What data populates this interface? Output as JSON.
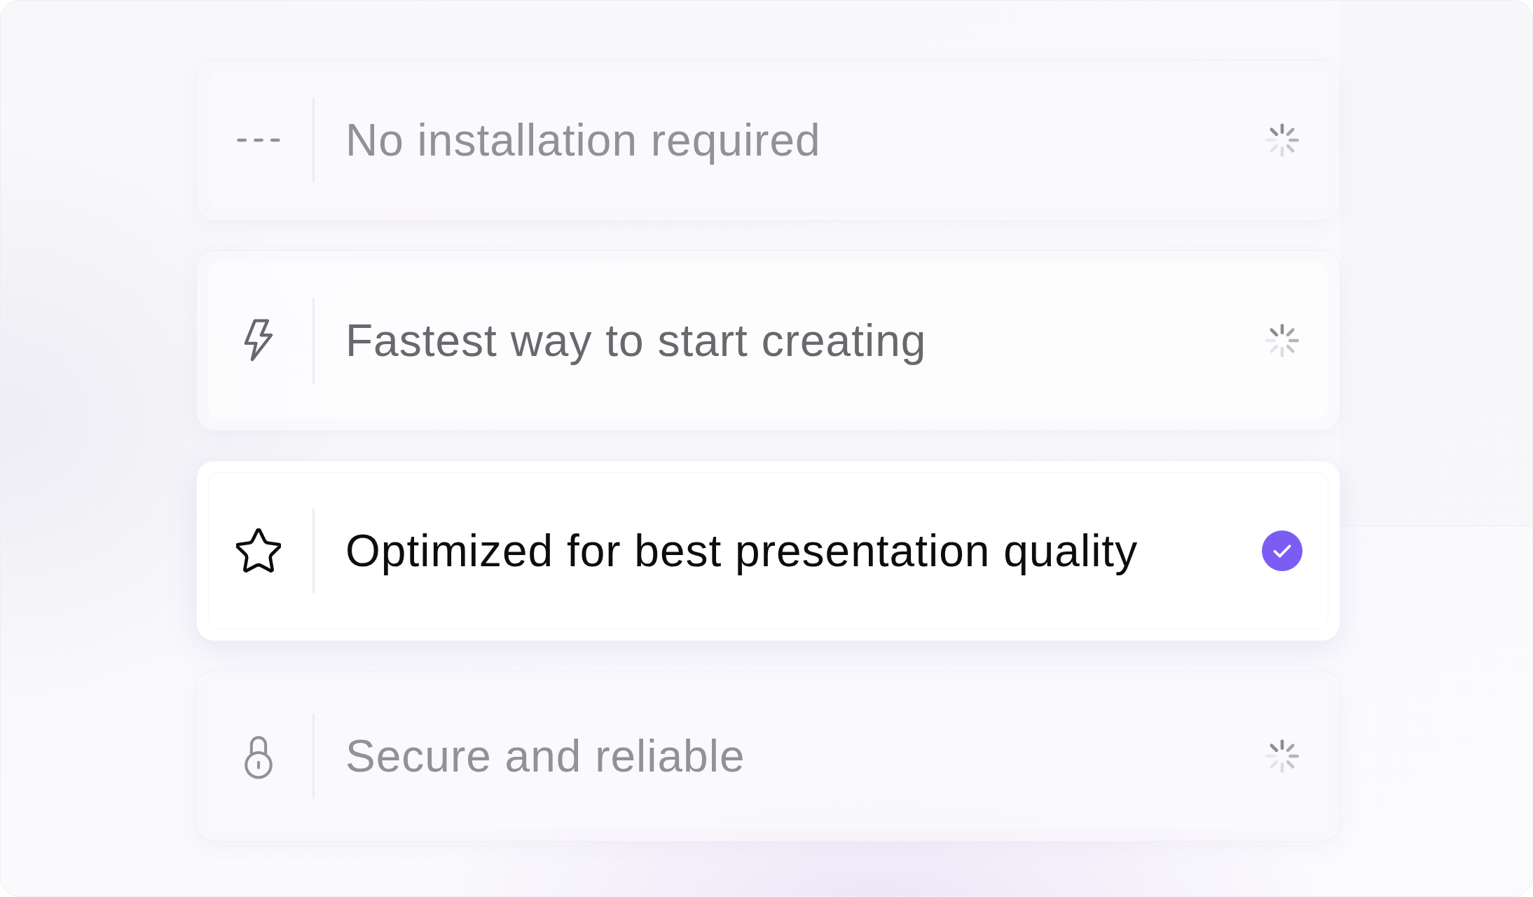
{
  "items": [
    {
      "label": "No installation required",
      "done": false,
      "dimmed": true
    },
    {
      "label": "Fastest way to start creating",
      "done": false,
      "dimmed": false
    },
    {
      "label": "Optimized for best presentation quality",
      "done": true,
      "dimmed": false
    },
    {
      "label": "Secure and reliable",
      "done": false,
      "dimmed": true
    }
  ]
}
